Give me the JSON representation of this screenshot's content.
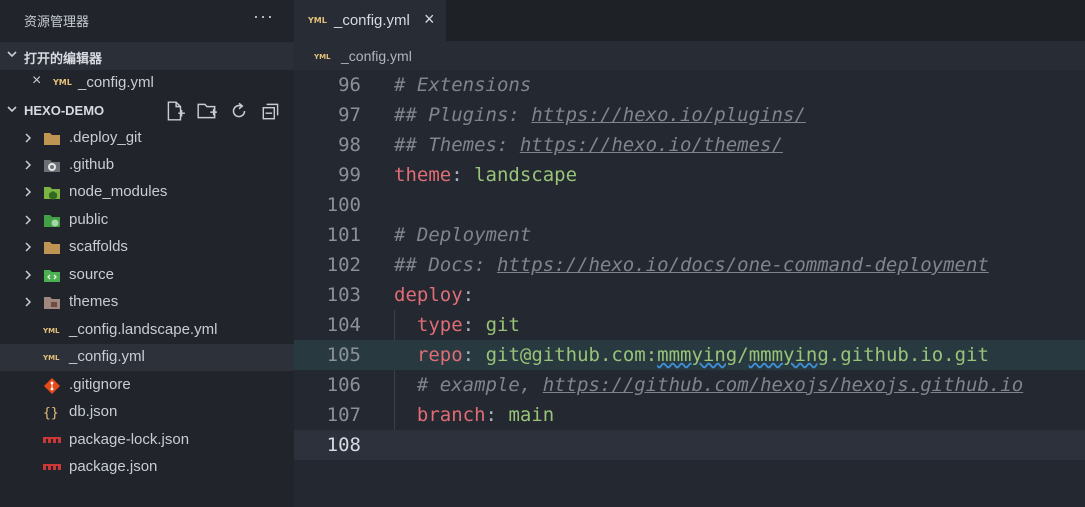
{
  "explorer": {
    "title": "资源管理器",
    "more": "···",
    "open_editors": {
      "header": "打开的编辑器",
      "files": [
        {
          "name": "_config.yml",
          "close": "×"
        }
      ]
    },
    "project": {
      "header": "HEXO-DEMO",
      "items": [
        {
          "name": ".deploy_git",
          "type": "folder",
          "icon": "folder-icon"
        },
        {
          "name": ".github",
          "type": "folder",
          "icon": "github-folder-icon"
        },
        {
          "name": "node_modules",
          "type": "folder",
          "icon": "node-folder-icon"
        },
        {
          "name": "public",
          "type": "folder",
          "icon": "public-folder-icon"
        },
        {
          "name": "scaffolds",
          "type": "folder",
          "icon": "folder-icon"
        },
        {
          "name": "source",
          "type": "folder",
          "icon": "source-folder-icon"
        },
        {
          "name": "themes",
          "type": "folder",
          "icon": "themes-folder-icon"
        },
        {
          "name": "_config.landscape.yml",
          "type": "file",
          "icon": "yaml-icon"
        },
        {
          "name": "_config.yml",
          "type": "file",
          "icon": "yaml-icon",
          "selected": true
        },
        {
          "name": ".gitignore",
          "type": "file",
          "icon": "git-icon"
        },
        {
          "name": "db.json",
          "type": "file",
          "icon": "json-icon"
        },
        {
          "name": "package-lock.json",
          "type": "file",
          "icon": "npm-icon"
        },
        {
          "name": "package.json",
          "type": "file",
          "icon": "npm-icon"
        }
      ]
    }
  },
  "editor": {
    "tab": {
      "name": "_config.yml",
      "close": "×"
    },
    "breadcrumb": "_config.yml",
    "lines": [
      {
        "num": "96",
        "text": "# Extensions"
      },
      {
        "num": "97",
        "text": "## Plugins: https://hexo.io/plugins/"
      },
      {
        "num": "98",
        "text": "## Themes: https://hexo.io/themes/"
      },
      {
        "num": "99",
        "text": "theme: landscape"
      },
      {
        "num": "100",
        "text": ""
      },
      {
        "num": "101",
        "text": "# Deployment"
      },
      {
        "num": "102",
        "text": "## Docs: https://hexo.io/docs/one-command-deployment"
      },
      {
        "num": "103",
        "text": "deploy:"
      },
      {
        "num": "104",
        "text": "  type: git"
      },
      {
        "num": "105",
        "text": "  repo: git@github.com:mmmying/mmmying.github.io.git"
      },
      {
        "num": "106",
        "text": "  # example, https://github.com/hexojs/hexojs.github.io"
      },
      {
        "num": "107",
        "text": "  branch: main"
      },
      {
        "num": "108",
        "text": ""
      }
    ]
  },
  "colors": {
    "sidebar_bg": "#21252b",
    "editor_bg": "#242830",
    "key": "#e06c75",
    "string": "#98c379",
    "comment": "#7f848e"
  }
}
